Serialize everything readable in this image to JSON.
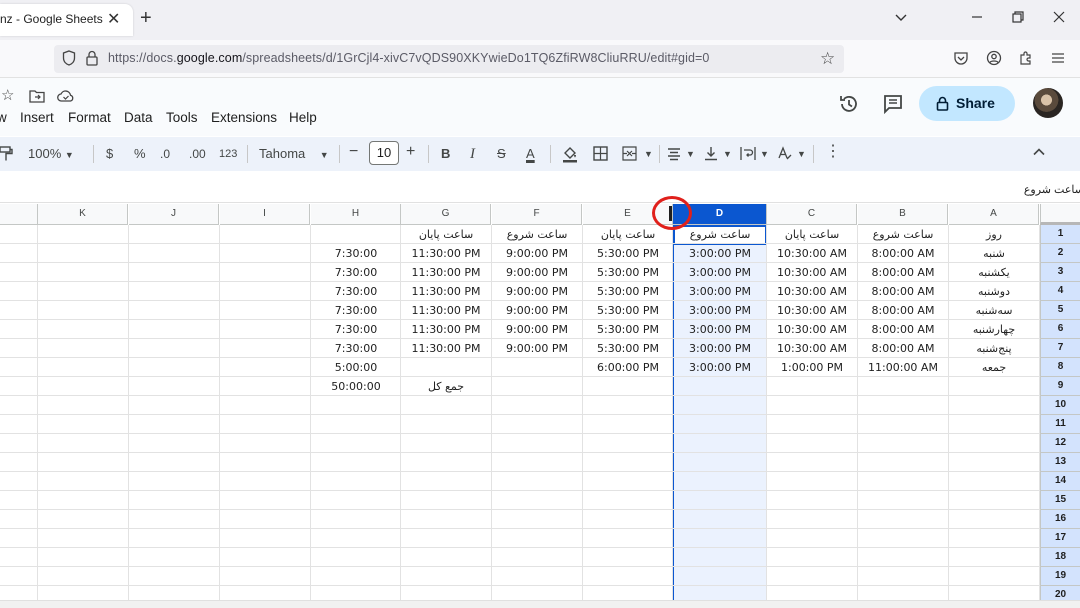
{
  "browser": {
    "tab_title": "nz - Google Sheets",
    "tab_close": "✕",
    "new_tab": "+",
    "url_prefix": "https://docs.",
    "url_domain": "google.com",
    "url_path": "/spreadsheets/d/1GrCjl4-xivC7vQDS90XKYwieDo1TQ6ZfiRW8CliuRRU/edit#gid=0"
  },
  "menu": [
    "w",
    "Insert",
    "Format",
    "Data",
    "Tools",
    "Extensions",
    "Help"
  ],
  "header": {
    "share_label": "Share"
  },
  "toolbar": {
    "zoom": "100%",
    "currency": "$",
    "percent": "%",
    "dec_decrease": ".0",
    "dec_increase": ".00",
    "number_format": "123",
    "font": "Tahoma",
    "font_size": "10",
    "minus": "−",
    "plus": "+",
    "bold": "B",
    "italic": "I",
    "strike": "S",
    "text_color": "A",
    "more": "⋮"
  },
  "formula_bar": {
    "content": "ساعت شروع"
  },
  "sheet": {
    "columns": [
      "K",
      "J",
      "I",
      "H",
      "G",
      "F",
      "E",
      "D",
      "C",
      "B",
      "A"
    ],
    "selected_column": "D",
    "rows": [
      "1",
      "2",
      "3",
      "4",
      "5",
      "6",
      "7",
      "8",
      "9",
      "10",
      "11",
      "12",
      "13",
      "14",
      "15",
      "16",
      "17",
      "18",
      "19",
      "20"
    ],
    "headers_row1": {
      "A": "روز",
      "B": "ساعت شروع",
      "C": "ساعت پایان",
      "D": "ساعت شروع",
      "E": "ساعت پایان",
      "F": "ساعت شروع",
      "G": "ساعت پایان"
    },
    "data": [
      {
        "A": "شنبه",
        "B": "8:00:00 AM",
        "C": "10:30:00 AM",
        "D": "3:00:00 PM",
        "E": "5:30:00 PM",
        "F": "9:00:00 PM",
        "G": "11:30:00 PM",
        "H": "7:30:00"
      },
      {
        "A": "یکشنبه",
        "B": "8:00:00 AM",
        "C": "10:30:00 AM",
        "D": "3:00:00 PM",
        "E": "5:30:00 PM",
        "F": "9:00:00 PM",
        "G": "11:30:00 PM",
        "H": "7:30:00"
      },
      {
        "A": "دوشنبه",
        "B": "8:00:00 AM",
        "C": "10:30:00 AM",
        "D": "3:00:00 PM",
        "E": "5:30:00 PM",
        "F": "9:00:00 PM",
        "G": "11:30:00 PM",
        "H": "7:30:00"
      },
      {
        "A": "سه‌شنبه",
        "B": "8:00:00 AM",
        "C": "10:30:00 AM",
        "D": "3:00:00 PM",
        "E": "5:30:00 PM",
        "F": "9:00:00 PM",
        "G": "11:30:00 PM",
        "H": "7:30:00"
      },
      {
        "A": "چهارشنبه",
        "B": "8:00:00 AM",
        "C": "10:30:00 AM",
        "D": "3:00:00 PM",
        "E": "5:30:00 PM",
        "F": "9:00:00 PM",
        "G": "11:30:00 PM",
        "H": "7:30:00"
      },
      {
        "A": "پنج‌شنبه",
        "B": "8:00:00 AM",
        "C": "10:30:00 AM",
        "D": "3:00:00 PM",
        "E": "5:30:00 PM",
        "F": "9:00:00 PM",
        "G": "11:30:00 PM",
        "H": "7:30:00"
      },
      {
        "A": "جمعه",
        "B": "11:00:00 AM",
        "C": "1:00:00 PM",
        "D": "3:00:00 PM",
        "E": "6:00:00 PM",
        "F": "",
        "G": "",
        "H": "5:00:00"
      }
    ],
    "total_label": "جمع کل",
    "total_value": "50:00:00"
  }
}
